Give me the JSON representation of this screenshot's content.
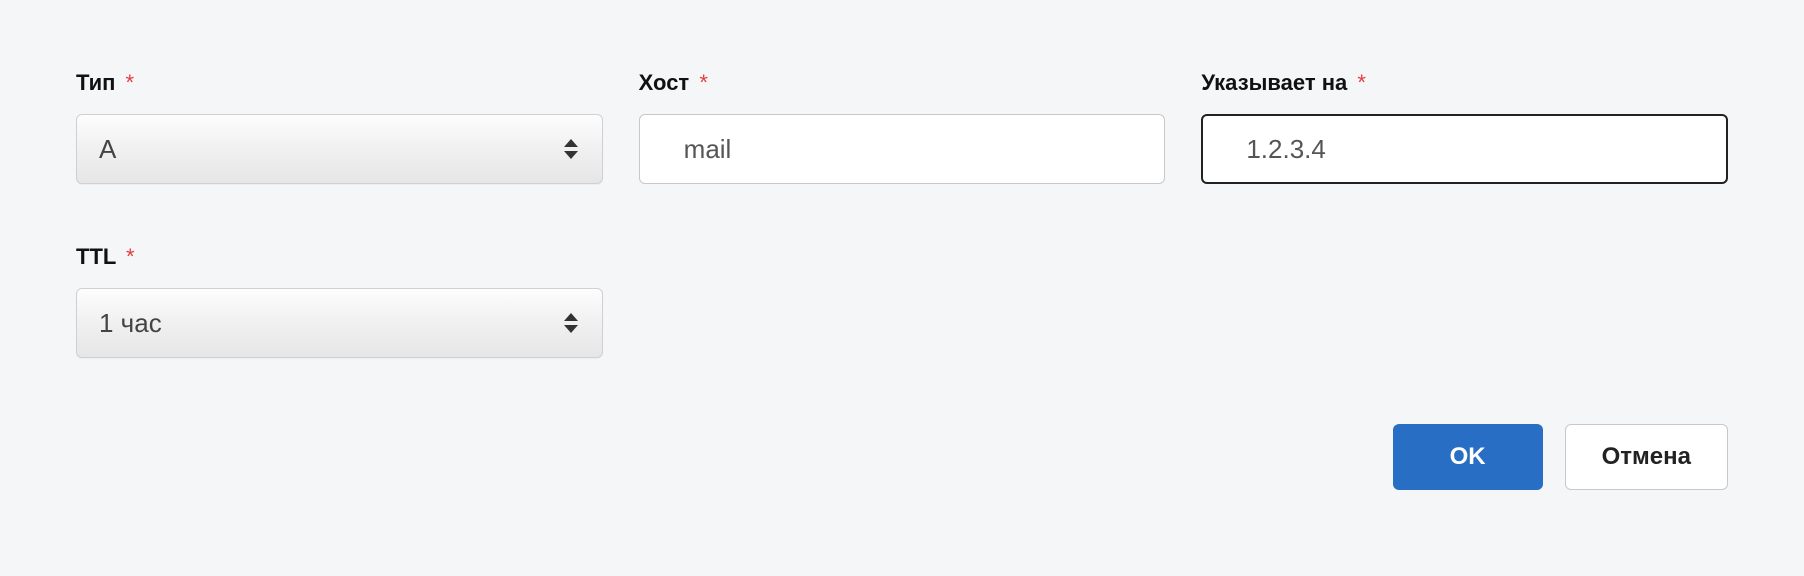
{
  "form": {
    "type": {
      "label": "Тип",
      "required_marker": "*",
      "value": "A"
    },
    "host": {
      "label": "Хост",
      "required_marker": "*",
      "value": "mail"
    },
    "points_to": {
      "label": "Указывает на",
      "required_marker": "*",
      "value": "1.2.3.4"
    },
    "ttl": {
      "label": "TTL",
      "required_marker": "*",
      "value": "1 час"
    }
  },
  "buttons": {
    "ok": "OK",
    "cancel": "Отмена"
  }
}
